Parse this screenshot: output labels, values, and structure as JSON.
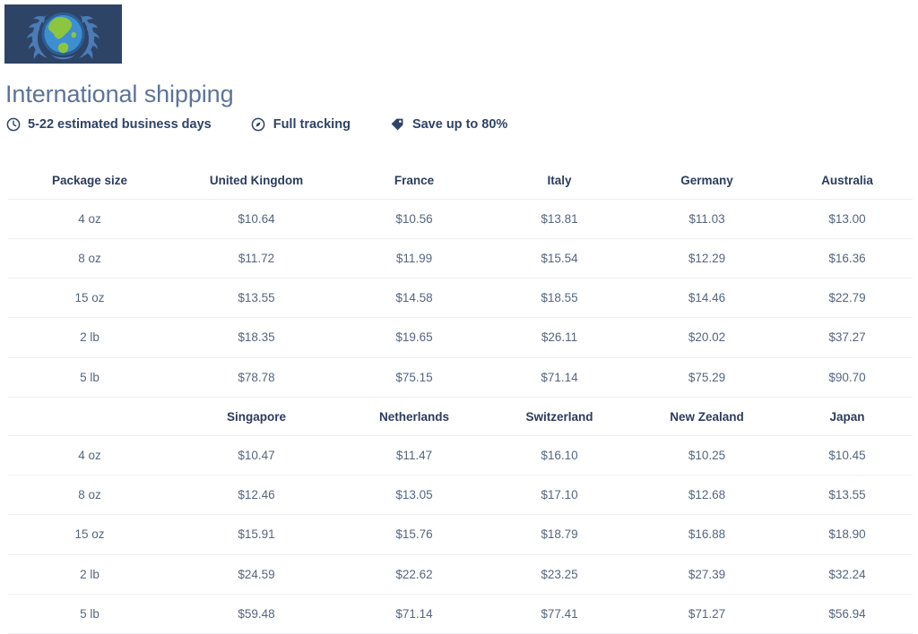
{
  "logo": {
    "name": "international-shipping-emblem",
    "background": "#2e4467",
    "globe_color": "#3d8fd1",
    "land_color": "#8cc63f",
    "wreath_color": "#4a7cb5",
    "alt": "Globe with laurel wreath emblem"
  },
  "header": {
    "title": "International shipping",
    "title_color": "#5c7497"
  },
  "features": [
    {
      "icon": "clock-icon",
      "label": "5-22 estimated business days"
    },
    {
      "icon": "compass-icon",
      "label": "Full tracking"
    },
    {
      "icon": "tag-icon",
      "label": "Save up to 80%"
    }
  ],
  "tables": [
    {
      "headers": [
        "Package size",
        "United Kingdom",
        "France",
        "Italy",
        "Germany",
        "Australia"
      ],
      "rows": [
        [
          "4 oz",
          "$10.64",
          "$10.56",
          "$13.81",
          "$11.03",
          "$13.00"
        ],
        [
          "8 oz",
          "$11.72",
          "$11.99",
          "$15.54",
          "$12.29",
          "$16.36"
        ],
        [
          "15 oz",
          "$13.55",
          "$14.58",
          "$18.55",
          "$14.46",
          "$22.79"
        ],
        [
          "2 lb",
          "$18.35",
          "$19.65",
          "$26.11",
          "$20.02",
          "$37.27"
        ],
        [
          "5 lb",
          "$78.78",
          "$75.15",
          "$71.14",
          "$75.29",
          "$90.70"
        ]
      ]
    },
    {
      "headers": [
        "",
        "Singapore",
        "Netherlands",
        "Switzerland",
        "New Zealand",
        "Japan"
      ],
      "rows": [
        [
          "4 oz",
          "$10.47",
          "$11.47",
          "$16.10",
          "$10.25",
          "$10.45"
        ],
        [
          "8 oz",
          "$12.46",
          "$13.05",
          "$17.10",
          "$12.68",
          "$13.55"
        ],
        [
          "15 oz",
          "$15.91",
          "$15.76",
          "$18.79",
          "$16.88",
          "$18.90"
        ],
        [
          "2 lb",
          "$24.59",
          "$22.62",
          "$23.25",
          "$27.39",
          "$32.24"
        ],
        [
          "5 lb",
          "$59.48",
          "$71.14",
          "$77.41",
          "$71.27",
          "$56.94"
        ]
      ]
    }
  ],
  "colors": {
    "header_text": "#2b3c5e",
    "cell_text": "#55657f",
    "rule": "#eceef0",
    "page_bg": "#ffffff"
  }
}
